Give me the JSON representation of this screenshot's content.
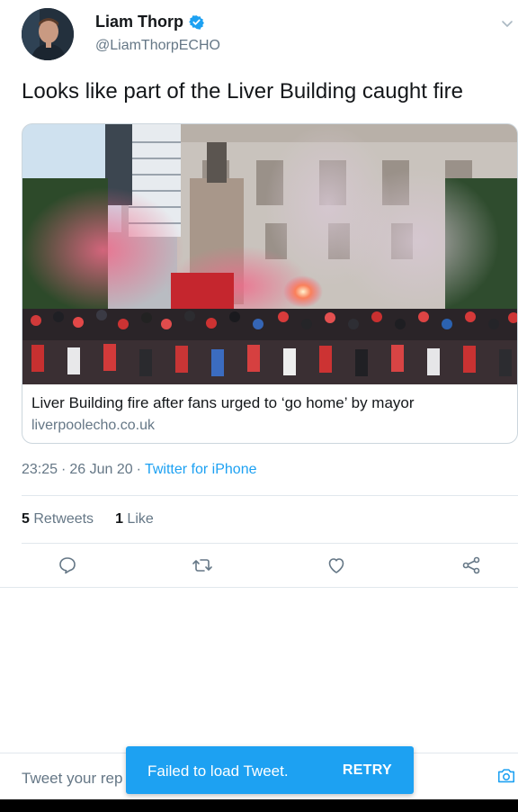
{
  "author": {
    "display_name": "Liam Thorp",
    "handle": "@LiamThorpECHO",
    "verified": true
  },
  "tweet": {
    "text": "Looks like part of the Liver Building caught fire"
  },
  "card": {
    "title": "Liver Building fire after fans urged to ‘go home’ by mayor",
    "domain": "liverpoolecho.co.uk",
    "image_alt": "crowd-with-red-flares"
  },
  "meta": {
    "time": "23:25",
    "dot1": "·",
    "date": "26 Jun 20",
    "dot2": "·",
    "source": "Twitter for iPhone"
  },
  "stats": {
    "retweets_count": "5",
    "retweets_label": "Retweets",
    "likes_count": "1",
    "likes_label": "Like"
  },
  "actions": [
    "reply-icon",
    "retweet-icon",
    "like-icon",
    "share-icon"
  ],
  "reply": {
    "placeholder": "Tweet your rep"
  },
  "toast": {
    "message": "Failed to load Tweet.",
    "action": "RETRY"
  },
  "colors": {
    "accent": "#1da1f2",
    "secondary_text": "#657786",
    "primary_text": "#14171a",
    "divider": "#e1e8ed"
  }
}
